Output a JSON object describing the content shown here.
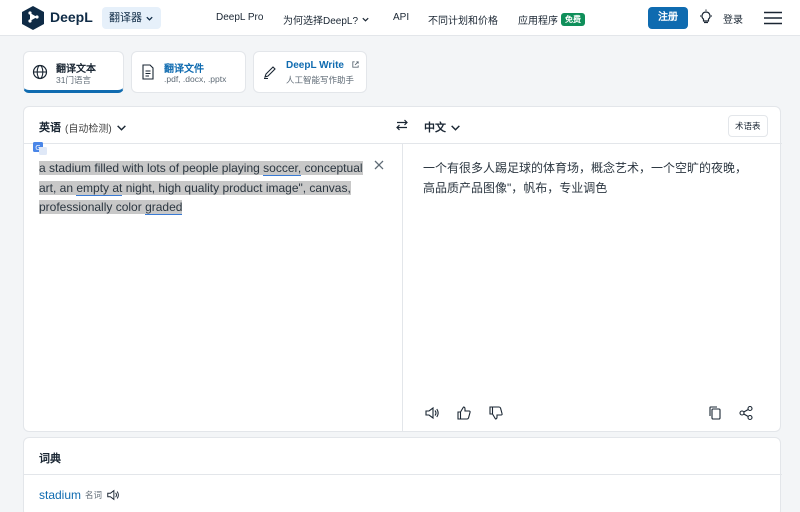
{
  "header": {
    "brand": "DeepL",
    "translator_label": "翻译器",
    "nav": {
      "pro": "DeepL Pro",
      "why": "为何选择DeepL?",
      "api": "API",
      "plans": "不同计划和价格",
      "apps": "应用程序",
      "free_badge": "免费"
    },
    "signup": "注册",
    "login": "登录"
  },
  "modes": [
    {
      "title": "翻译文本",
      "sub": "31门语言",
      "icon": "globe-icon"
    },
    {
      "title": "翻译文件",
      "sub": ".pdf, .docx, .pptx",
      "icon": "document-icon"
    },
    {
      "title": "DeepL Write",
      "sub": "人工智能写作助手",
      "icon": "pen-icon"
    }
  ],
  "translator": {
    "source_lang": "英语",
    "source_detect": "(自动检测)",
    "target_lang": "中文",
    "glossary": "术语表",
    "source_text": {
      "p1": "a stadium filled with lots of people playing ",
      "w1": "soccer,",
      "p2": " conceptual art, an ",
      "w2": "empty  at",
      "p3": " night, high quality product image\", canvas, professionally color ",
      "w3": "graded"
    },
    "target_text": "一个有很多人踢足球的体育场，概念艺术，一个空旷的夜晚，高品质产品图像\"，帆布，专业调色"
  },
  "dictionary": {
    "title": "词典",
    "word": "stadium",
    "pos": "名词"
  },
  "colors": {
    "accent": "#0f6bb0",
    "free_badge": "#0f8f5a",
    "highlight": "#c8c8c8"
  }
}
